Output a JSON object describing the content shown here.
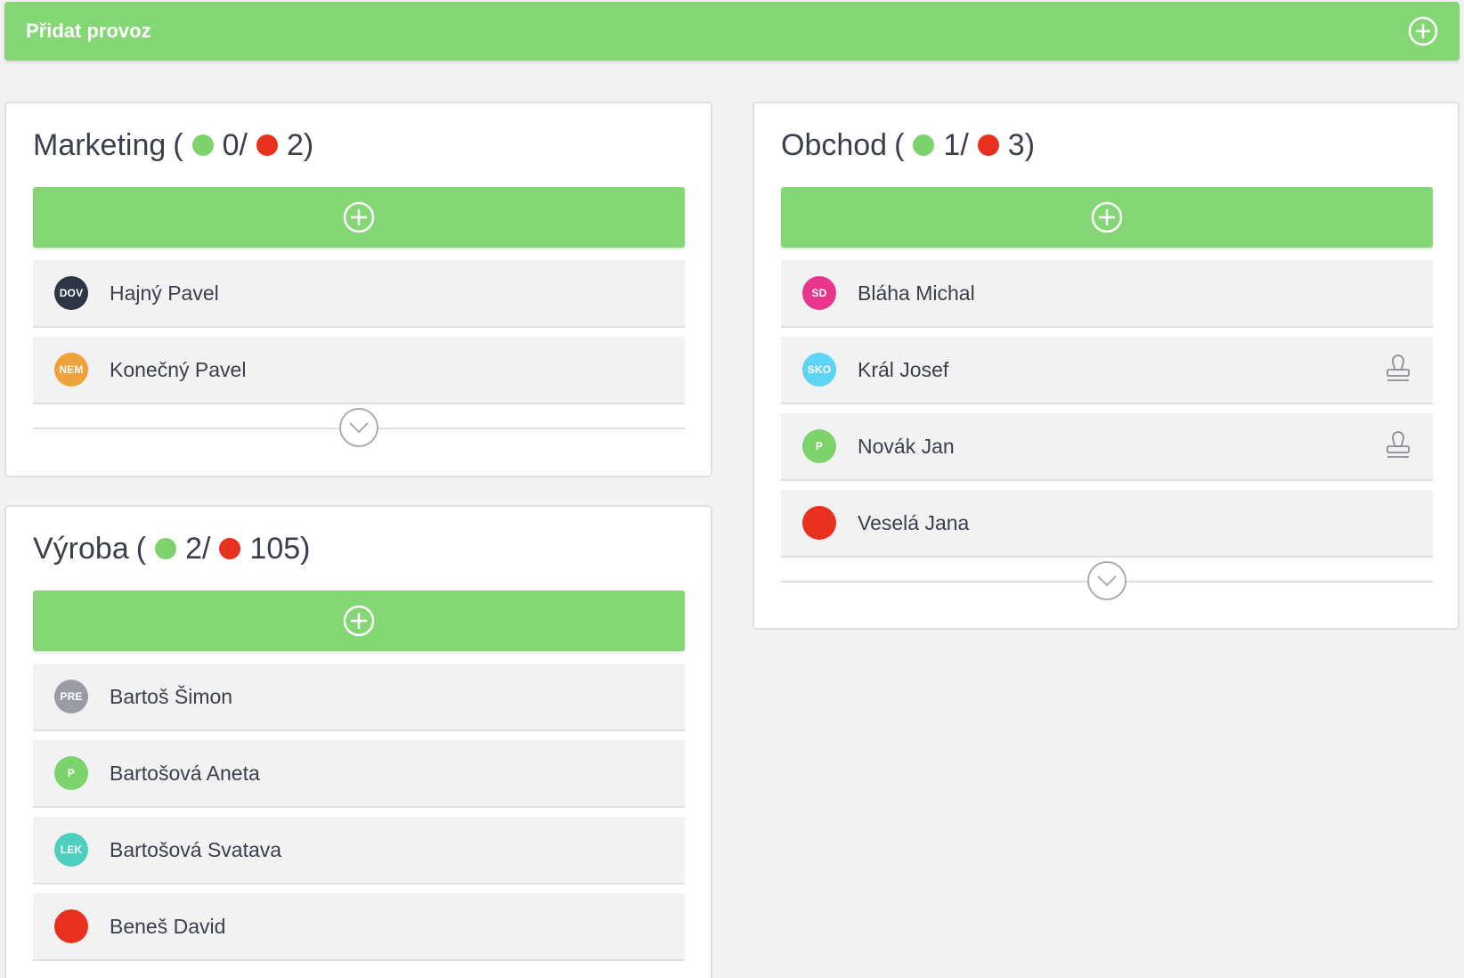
{
  "topbar": {
    "title": "Přidat provoz",
    "icon": "plus-circle-icon"
  },
  "colors": {
    "green": "#85d675",
    "red": "#e8301e",
    "text": "#3a3f4b"
  },
  "groups": {
    "marketing": {
      "name": "Marketing",
      "green_count": "0/",
      "red_count": "2)",
      "members": [
        {
          "initials": "DOV",
          "name": "Hajný Pavel",
          "color": "#2f3545"
        },
        {
          "initials": "NEM",
          "name": "Konečný Pavel",
          "color": "#f0a23a"
        }
      ]
    },
    "obchod": {
      "name": "Obchod",
      "green_count": "1/",
      "red_count": "3)",
      "members": [
        {
          "initials": "SD",
          "name": "Bláha Michal",
          "color": "#e9358c"
        },
        {
          "initials": "SKO",
          "name": "Král Josef",
          "color": "#5fd3f3",
          "icon": "stamp-icon"
        },
        {
          "initials": "P",
          "name": "Novák Jan",
          "color": "#7dd36b",
          "icon": "stamp-icon"
        },
        {
          "initials": "",
          "name": "Veselá Jana",
          "color": "#e8301e"
        }
      ]
    },
    "vyroba": {
      "name": "Výroba",
      "green_count": "2/",
      "red_count": "105)",
      "members": [
        {
          "initials": "PRE",
          "name": "Bartoš Šimon",
          "color": "#9a9ca3"
        },
        {
          "initials": "P",
          "name": "Bartošová Aneta",
          "color": "#7dd36b"
        },
        {
          "initials": "LEK",
          "name": "Bartošová Svatava",
          "color": "#4fcfc0"
        },
        {
          "initials": "",
          "name": "Beneš David",
          "color": "#e8301e"
        }
      ]
    }
  }
}
